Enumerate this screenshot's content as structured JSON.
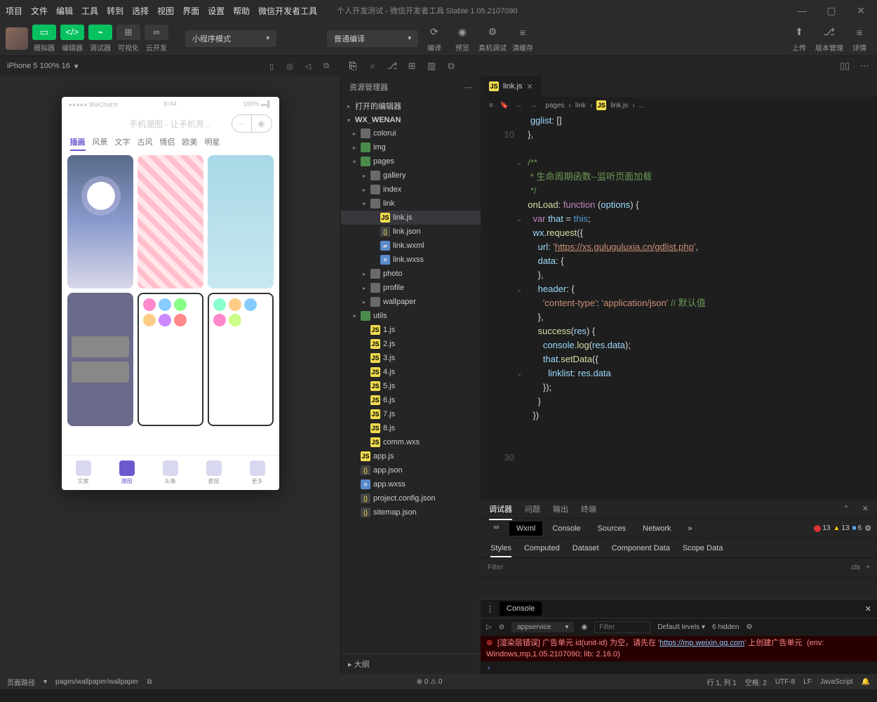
{
  "menus": [
    "项目",
    "文件",
    "编辑",
    "工具",
    "转到",
    "选择",
    "视图",
    "界面",
    "设置",
    "帮助",
    "微信开发者工具"
  ],
  "title": "个人开发测试 - 微信开发者工具 Stable 1.05.2107090",
  "toolbar": {
    "sim": "模拟器",
    "edit": "编辑器",
    "debug": "调试器",
    "vis": "可视化",
    "cloud": "云开发",
    "mode": "小程序模式",
    "compile": "普通编译",
    "compile_btn": "编译",
    "preview": "预览",
    "realdbg": "真机调试",
    "clear": "清缓存",
    "upload": "上传",
    "version": "版本管理",
    "detail": "详情"
  },
  "simHeader": {
    "device": "iPhone 5 100% 16",
    "arrow": "▾"
  },
  "phone": {
    "carrier": "●●●●● WeChat",
    "wifi": "ᯤ",
    "time": "8:44",
    "battery": "100%",
    "title": "手机潮图 - 让手机秀...",
    "tabs": [
      "插画",
      "风景",
      "文字",
      "古风",
      "情侣",
      "欧美",
      "明星"
    ],
    "nav": [
      "文案",
      "潮图",
      "头像",
      "套图",
      "更多"
    ]
  },
  "explorer": {
    "header": "资源管理器",
    "openEditors": "打开的编辑器",
    "project": "WX_WENAN",
    "tree": {
      "colorui": "colorui",
      "img": "img",
      "pages": "pages",
      "gallery": "gallery",
      "index": "index",
      "link": "link",
      "linkjs": "link.js",
      "linkjson": "link.json",
      "linkwxml": "link.wxml",
      "linkwxss": "link.wxss",
      "photo": "photo",
      "profile": "profile",
      "wallpaper": "wallpaper",
      "utils": "utils",
      "j1": "1.js",
      "j2": "2.js",
      "j3": "3.js",
      "j4": "4.js",
      "j5": "5.js",
      "j6": "6.js",
      "j7": "7.js",
      "j8": "8.js",
      "commwxs": "comm.wxs",
      "appjs": "app.js",
      "appjson": "app.json",
      "appwxss": "app.wxss",
      "projconf": "project.config.json",
      "sitemap": "sitemap.json"
    },
    "outline": "大纲"
  },
  "tab": {
    "name": "link.js"
  },
  "crumb": [
    "pages",
    "link",
    "link.js",
    "..."
  ],
  "code": {
    "lines": [
      "",
      "10",
      "",
      "",
      "",
      "",
      "",
      "",
      "",
      "",
      "",
      "",
      "",
      "",
      "",
      "",
      "",
      "",
      "",
      "",
      "",
      "",
      "",
      "",
      "",
      "",
      "",
      "",
      "",
      "30",
      ""
    ],
    "onLoad": "onLoad",
    "func": "function",
    "options": "options",
    "var": "var",
    "that": "that",
    "this": "this",
    "wx": "wx",
    "request": "request",
    "url": "url",
    "urlval": "https://xs.guluguluxia.cn/gdlist.php",
    "data": "data",
    "header": "header",
    "ct": "content-type",
    "aj": "application/json",
    "cmt": "// 默认值",
    "success": "success",
    "res": "res",
    "console": "console",
    "log": "log",
    "resdata": "res.data",
    "setData": "setData",
    "linklist": "linklist",
    "gglist": "gglist",
    "doc1": "/**",
    "doc2": " * 生命周期函数--监听页面加载",
    "doc3": " */"
  },
  "debugger": {
    "tabs": [
      "调试器",
      "问题",
      "输出",
      "终端"
    ],
    "insp": [
      "Wxml",
      "Console",
      "Sources",
      "Network"
    ],
    "badges": {
      "err": "13",
      "warn": "13",
      "info": "6"
    },
    "subtabs": [
      "Styles",
      "Computed",
      "Dataset",
      "Component Data",
      "Scope Data"
    ],
    "filter": "Filter",
    "cls": ".cls"
  },
  "console": {
    "tab": "Console",
    "ctx": "appservice",
    "filter": "Filter",
    "levels": "Default levels",
    "hidden": "6 hidden",
    "err1": "[渲染层错误] 广告单元 id(unit-id) 为空，请先在 '",
    "errurl": "https://mp.weixin.qq.com",
    "err2": "' 上创建广告单元",
    "env": "(env: Windows,mp,1.05.2107090; lib: 2.16.0)"
  },
  "status": {
    "routeLabel": "页面路径",
    "route": "pages/wallpaper/wallpaper",
    "issues": "0",
    "warn": "0",
    "pos": "行 1, 列 1",
    "spaces": "空格: 2",
    "enc": "UTF-8",
    "eol": "LF",
    "lang": "JavaScript"
  }
}
